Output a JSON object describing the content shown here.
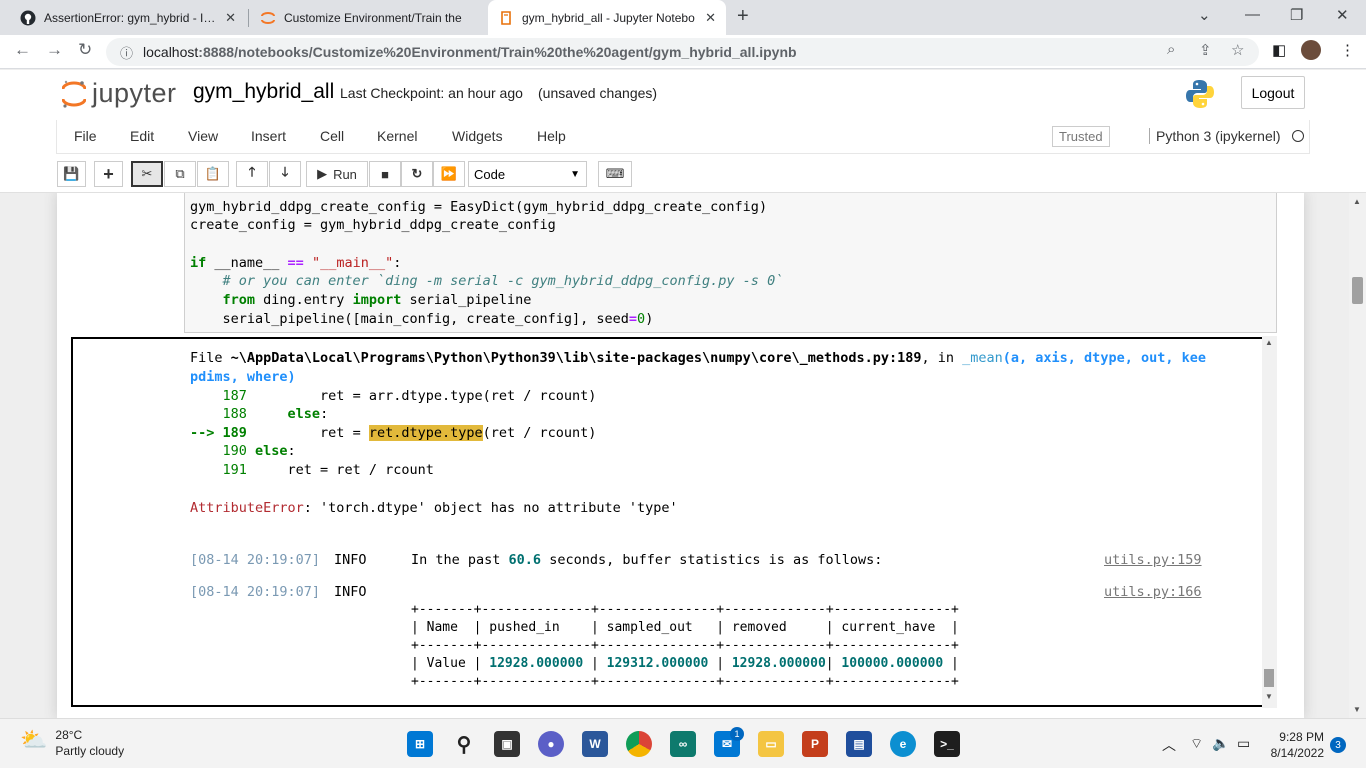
{
  "browser": {
    "tabs": [
      {
        "title": "AssertionError: gym_hybrid - Issu"
      },
      {
        "title": "Customize Environment/Train the"
      },
      {
        "title": "gym_hybrid_all - Jupyter Notebo"
      }
    ],
    "address": {
      "host": "localhost",
      "path": ":8888/notebooks/Customize%20Environment/Train%20the%20agent/gym_hybrid_all.ipynb"
    }
  },
  "jupyter": {
    "logo_text": "jupyter",
    "notebook_name": "gym_hybrid_all",
    "checkpoint": "Last Checkpoint: an hour ago",
    "unsaved": "(unsaved changes)",
    "logout_label": "Logout",
    "menus": [
      "File",
      "Edit",
      "View",
      "Insert",
      "Cell",
      "Kernel",
      "Widgets",
      "Help"
    ],
    "trusted": "Trusted",
    "kernel": "Python 3 (ipykernel)",
    "toolbar": {
      "run_label": "Run",
      "cell_type": "Code"
    }
  },
  "code": {
    "line1": "gym_hybrid_ddpg_create_config = EasyDict(gym_hybrid_ddpg_create_config)",
    "line2": "create_config = gym_hybrid_ddpg_create_config",
    "if_kw": "if",
    "if_name": " __name__ ",
    "if_op": "==",
    "if_str": " \"__main__\"",
    "if_end": ":",
    "comment": "    # or you can enter `ding -m serial -c gym_hybrid_ddpg_config.py -s 0`",
    "from_kw": "from",
    "from_mod": " ding.entry ",
    "import_kw": "import",
    "import_name": " serial_pipeline",
    "call_pre": "    serial_pipeline([main_config, create_config], seed",
    "call_eq": "=",
    "call_num": "0",
    "call_post": ")"
  },
  "output": {
    "file_label": "File ",
    "file_path": "~\\AppData\\Local\\Programs\\Python\\Python39\\lib\\site-packages\\numpy\\core\\_methods.py:189",
    "in_label": ", in ",
    "func": "_mean",
    "args1": "(a, axis, dtype, out, kee",
    "args2": "pdims, where)",
    "l187_num": "187",
    "l187_code": "         ret = arr.dtype.type(ret / rcount)",
    "l188_num": "188",
    "l188_kw": "     else",
    "l188_end": ":",
    "arrow": "--> 189",
    "l189_pre": "         ret = ",
    "l189_hl": "ret.dtype.type",
    "l189_post": "(ret / rcount)",
    "l190_num": "190",
    "l190_kw": " else",
    "l190_end": ":",
    "l191_num": "191",
    "l191_code": "     ret = ret / rcount",
    "error_name": "AttributeError",
    "error_msg": ": 'torch.dtype' object has no attribute 'type'",
    "log1_ts": "[08-14 20:19:07]",
    "log1_level": "INFO",
    "log1_pre": "In the past ",
    "log1_num": "60.6",
    "log1_post": " seconds, buffer statistics is as follows:",
    "log1_link": "utils.py",
    "log1_line": ":159",
    "log2_ts": "[08-14 20:19:07]",
    "log2_level": "INFO",
    "log2_link": "utils.py",
    "log2_line": ":166",
    "table_border": "+-------+--------------+---------------+-------------+---------------+",
    "table_headers": [
      "Name",
      "pushed_in",
      "sampled_out",
      "removed",
      "current_have"
    ],
    "table_row_label": "Value",
    "table_values": [
      "12928.000000",
      "129312.000000",
      "12928.000000",
      "100000.000000"
    ]
  },
  "taskbar": {
    "temp": "28°C",
    "weather": "Partly cloudy",
    "time": "9:28 PM",
    "date": "8/14/2022",
    "notifications": "3",
    "mail_badge": "1"
  }
}
